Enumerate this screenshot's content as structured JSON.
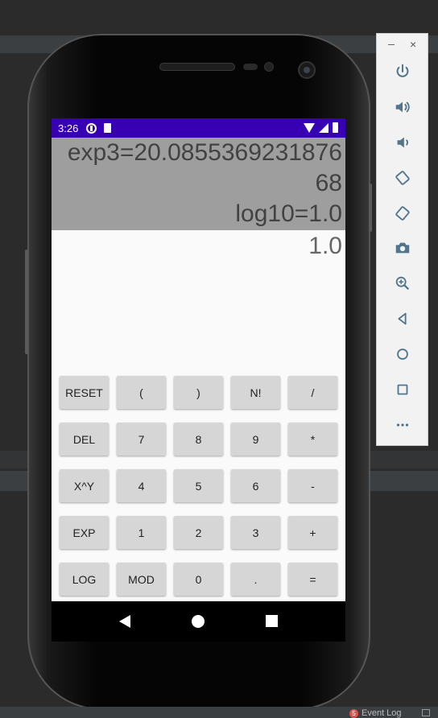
{
  "device": {
    "status_bar": {
      "time": "3:26"
    },
    "calculator": {
      "history_lines": [
        "exp3=20.0855369231876",
        "68",
        "log10=1.0"
      ],
      "result": "1.0",
      "keys": [
        [
          "RESET",
          "(",
          ")",
          "N!",
          "/"
        ],
        [
          "DEL",
          "7",
          "8",
          "9",
          "*"
        ],
        [
          "X^Y",
          "4",
          "5",
          "6",
          "-"
        ],
        [
          "EXP",
          "1",
          "2",
          "3",
          "+"
        ],
        [
          "LOG",
          "MOD",
          "0",
          ".",
          "="
        ]
      ]
    }
  },
  "emulator_toolbar": {
    "window_controls": {
      "minimize": "−",
      "close": "×"
    },
    "buttons": [
      "power-icon",
      "volume-up-icon",
      "volume-down-icon",
      "rotate-left-icon",
      "rotate-right-icon",
      "camera-icon",
      "zoom-icon",
      "back-icon",
      "home-icon",
      "overview-icon",
      "more-icon"
    ]
  },
  "ide_status_bar": {
    "event_log_count": "5",
    "event_log_label": "Event Log"
  },
  "colors": {
    "status_bar": "#3700b3",
    "history_background": "#9e9e9e",
    "key_background": "#d6d6d6"
  }
}
